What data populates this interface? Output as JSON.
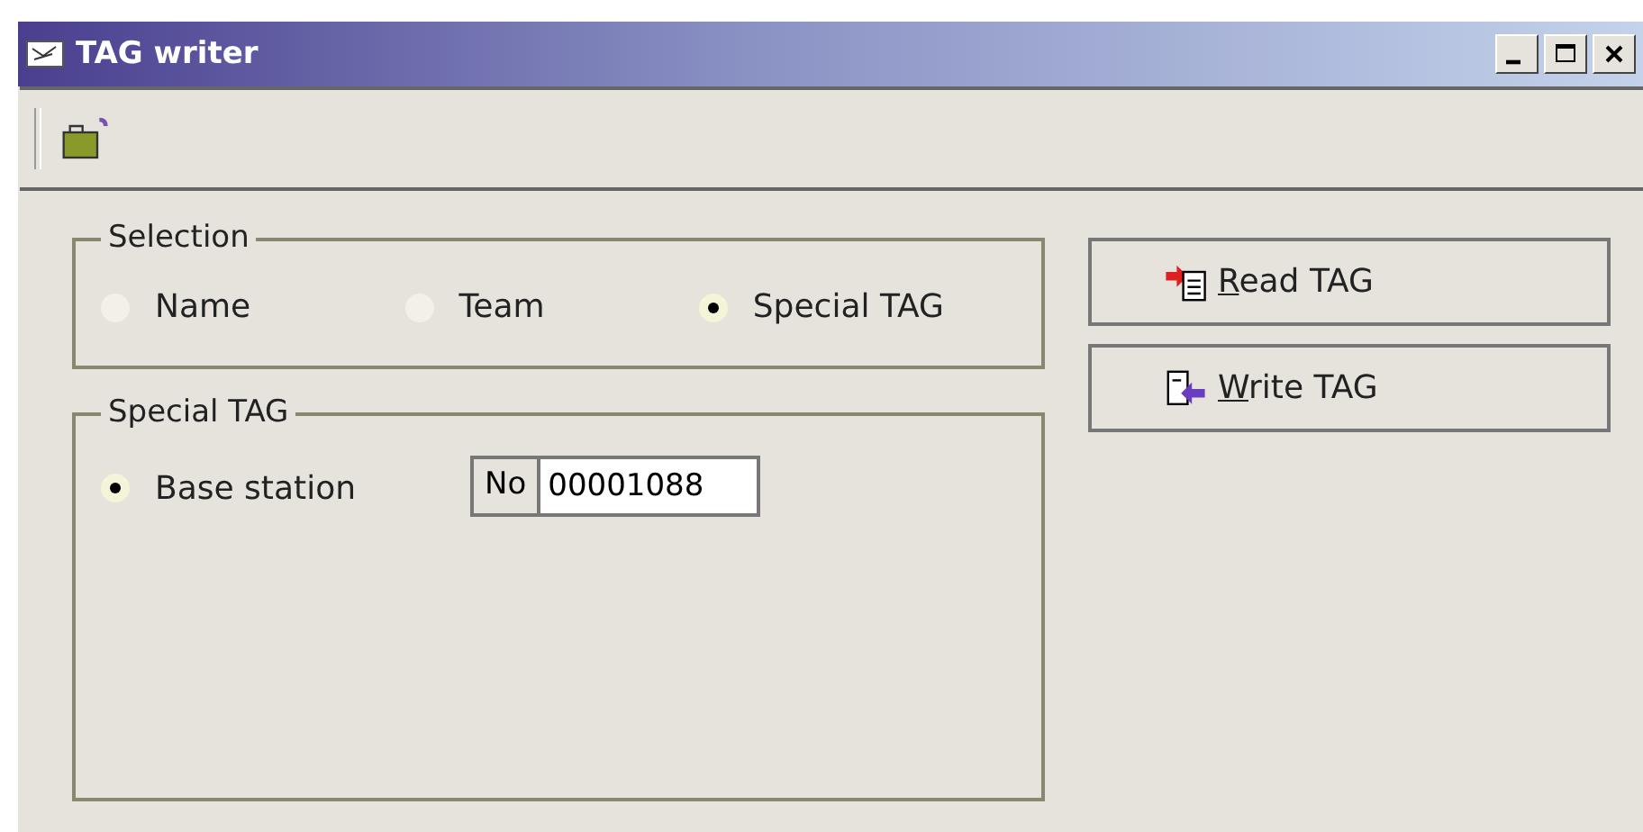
{
  "window": {
    "title": "TAG writer",
    "controls": [
      {
        "kind": "minimize"
      },
      {
        "kind": "maximize"
      },
      {
        "kind": "close"
      }
    ]
  },
  "toolbar": {
    "items": [
      {
        "kind": "open"
      }
    ]
  },
  "selection": {
    "title": "Selection",
    "options": [
      {
        "label": "Name",
        "selected": false
      },
      {
        "label": "Team",
        "selected": false
      },
      {
        "label": "Special TAG",
        "selected": true
      }
    ]
  },
  "special_tag": {
    "title": "Special TAG",
    "options": [
      {
        "label": "Base station",
        "selected": true
      }
    ],
    "field_label": "No",
    "field_value": "00001088"
  },
  "buttons": [
    {
      "kind": "read",
      "label": "Read TAG"
    },
    {
      "kind": "write",
      "label": "Write TAG"
    }
  ]
}
